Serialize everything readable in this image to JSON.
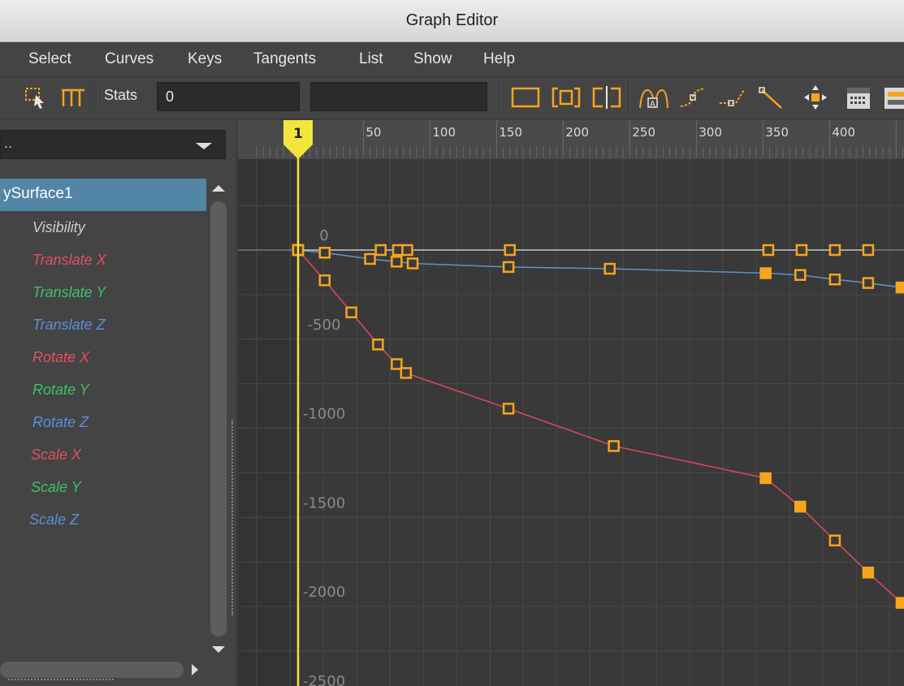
{
  "window": {
    "title": "Graph Editor"
  },
  "menu": [
    "Select",
    "Curves",
    "Keys",
    "Tangents",
    "List",
    "Show",
    "Help"
  ],
  "toolbar": {
    "stats_label": "Stats",
    "stats_value": "0",
    "stats_value2": "",
    "icons": [
      "select-key-icon",
      "lattice-deform-icon",
      "frame-all-icon",
      "frame-selection-icon",
      "frame-playback-icon",
      "auto-tangent-icon",
      "spline-tangent-icon",
      "linear-tangent-icon",
      "step-tangent-icon",
      "move-nearest-icon",
      "dope-sheet-icon",
      "trax-editor-icon"
    ]
  },
  "outliner": {
    "filter_text": "..",
    "node": "ySurface1",
    "attributes": [
      {
        "label": "Visibility",
        "color": "#cfcfcf"
      },
      {
        "label": "Translate X",
        "color": "#e2505e"
      },
      {
        "label": "Translate Y",
        "color": "#3fbf6a"
      },
      {
        "label": "Translate Z",
        "color": "#5b8fd6"
      },
      {
        "label": "Rotate X",
        "color": "#e2505e"
      },
      {
        "label": "Rotate Y",
        "color": "#3fbf6a"
      },
      {
        "label": "Rotate Z",
        "color": "#5b8fd6"
      },
      {
        "label": "Scale X",
        "color": "#e2505e"
      },
      {
        "label": "Scale Y",
        "color": "#3fbf6a"
      },
      {
        "label": "Scale Z",
        "color": "#5b8fd6"
      }
    ]
  },
  "graph": {
    "current_frame_label": "1",
    "x_ticks": [
      {
        "value": 50,
        "label": "50"
      },
      {
        "value": 100,
        "label": "100"
      },
      {
        "value": 150,
        "label": "150"
      },
      {
        "value": 200,
        "label": "200"
      },
      {
        "value": 250,
        "label": "250"
      },
      {
        "value": 300,
        "label": "300"
      },
      {
        "value": 350,
        "label": "350"
      },
      {
        "value": 400,
        "label": "400"
      }
    ],
    "y_ticks": [
      {
        "value": 0,
        "label": "0"
      },
      {
        "value": -500,
        "label": "-500"
      },
      {
        "value": -1000,
        "label": "-1000"
      },
      {
        "value": -1500,
        "label": "-1500"
      },
      {
        "value": -2000,
        "label": "-2000"
      },
      {
        "value": -2500,
        "label": "-2500"
      }
    ],
    "colors": {
      "background": "#393939",
      "grid": "#4a4a4a",
      "zero_line": "#9a9a9a",
      "timeline": "#f3e53c",
      "key": "#f7a51c",
      "curve_red": "#d9465a",
      "curve_blue": "#5f8fc4",
      "curve_white": "#c8c8c8",
      "ruler": "#4a4a4a"
    },
    "curves": [
      {
        "name": "Translate X",
        "color": "#d9465a",
        "keys": [
          [
            1,
            0
          ],
          [
            21,
            -170
          ],
          [
            41,
            -350
          ],
          [
            61,
            -530
          ],
          [
            75,
            -640
          ],
          [
            82,
            -690
          ],
          [
            159,
            -890
          ],
          [
            238,
            -1100
          ],
          [
            352,
            -1280
          ],
          [
            378,
            -1440
          ],
          [
            404,
            -1630
          ],
          [
            429,
            -1810
          ],
          [
            454,
            -1980
          ]
        ]
      },
      {
        "name": "Translate Z",
        "color": "#5f8fc4",
        "keys": [
          [
            1,
            0
          ],
          [
            21,
            -15
          ],
          [
            55,
            -50
          ],
          [
            75,
            -65
          ],
          [
            87,
            -75
          ],
          [
            159,
            -95
          ],
          [
            235,
            -105
          ],
          [
            352,
            -130
          ],
          [
            378,
            -140
          ],
          [
            404,
            -165
          ],
          [
            429,
            -185
          ],
          [
            454,
            -210
          ]
        ]
      },
      {
        "name": "Visibility",
        "color": "#c8c8c8",
        "keys": [
          [
            1,
            0
          ],
          [
            63,
            0
          ],
          [
            76,
            0
          ],
          [
            83,
            0
          ],
          [
            160,
            0
          ],
          [
            354,
            0
          ],
          [
            379,
            0
          ],
          [
            404,
            0
          ],
          [
            429,
            0
          ]
        ]
      }
    ]
  }
}
